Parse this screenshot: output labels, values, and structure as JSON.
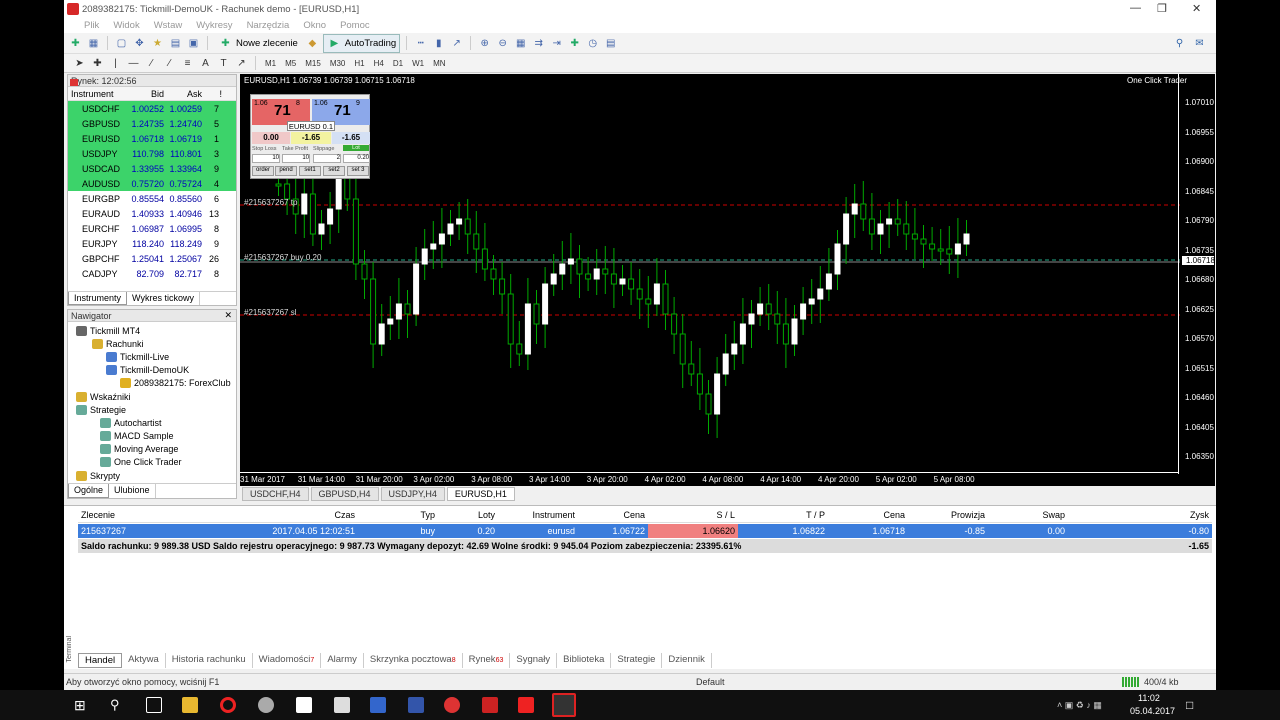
{
  "window": {
    "title": "2089382175: Tickmill-DemoUK - Rachunek demo - [EURUSD,H1]"
  },
  "menu": [
    "Plik",
    "Widok",
    "Wstaw",
    "Wykresy",
    "Narzędzia",
    "Okno",
    "Pomoc"
  ],
  "toolbar": {
    "new_order": "Nowe zlecenie",
    "autotrading": "AutoTrading",
    "timeframes": [
      "M1",
      "M5",
      "M15",
      "M30",
      "H1",
      "H4",
      "D1",
      "W1",
      "MN"
    ]
  },
  "market_watch": {
    "title": "Rynek: 12:02:56",
    "headers": [
      "Instrument",
      "Bid",
      "Ask",
      "!"
    ],
    "rows": [
      {
        "sym": "USDCHF",
        "bid": "1.00252",
        "ask": "1.00259",
        "spread": "7",
        "hl": true
      },
      {
        "sym": "GBPUSD",
        "bid": "1.24735",
        "ask": "1.24740",
        "spread": "5",
        "hl": true
      },
      {
        "sym": "EURUSD",
        "bid": "1.06718",
        "ask": "1.06719",
        "spread": "1",
        "hl": true
      },
      {
        "sym": "USDJPY",
        "bid": "110.798",
        "ask": "110.801",
        "spread": "3",
        "hl": true
      },
      {
        "sym": "USDCAD",
        "bid": "1.33955",
        "ask": "1.33964",
        "spread": "9",
        "hl": true
      },
      {
        "sym": "AUDUSD",
        "bid": "0.75720",
        "ask": "0.75724",
        "spread": "4",
        "hl": true
      },
      {
        "sym": "EURGBP",
        "bid": "0.85554",
        "ask": "0.85560",
        "spread": "6",
        "hl": false
      },
      {
        "sym": "EURAUD",
        "bid": "1.40933",
        "ask": "1.40946",
        "spread": "13",
        "hl": false
      },
      {
        "sym": "EURCHF",
        "bid": "1.06987",
        "ask": "1.06995",
        "spread": "8",
        "hl": false
      },
      {
        "sym": "EURJPY",
        "bid": "118.240",
        "ask": "118.249",
        "spread": "9",
        "hl": false
      },
      {
        "sym": "GBPCHF",
        "bid": "1.25041",
        "ask": "1.25067",
        "spread": "26",
        "hl": false
      },
      {
        "sym": "CADJPY",
        "bid": "82.709",
        "ask": "82.717",
        "spread": "8",
        "hl": false
      }
    ],
    "tabs": [
      "Instrumenty",
      "Wykres tickowy"
    ]
  },
  "navigator": {
    "title": "Nawigator",
    "items": [
      "Tickmill MT4",
      "Rachunki",
      "Tickmill-Live",
      "Tickmill-DemoUK",
      "2089382175: ForexClub",
      "Wskaźniki",
      "Strategie",
      "Autochartist",
      "MACD Sample",
      "Moving Average",
      "One Click Trader",
      "Skrypty"
    ],
    "tabs": [
      "Ogólne",
      "Ulubione"
    ]
  },
  "chart": {
    "header": "EURUSD,H1  1.06739 1.06739 1.06715 1.06718",
    "one_click": "One Click Trader",
    "prices": [
      "1.07010",
      "1.06955",
      "1.06900",
      "1.06845",
      "1.06790",
      "1.06735",
      "1.06680",
      "1.06625",
      "1.06570",
      "1.06515",
      "1.06460",
      "1.06405",
      "1.06350"
    ],
    "current_price": "1.06718",
    "times": [
      "31 Mar 2017",
      "31 Mar 14:00",
      "31 Mar 20:00",
      "3 Apr 02:00",
      "3 Apr 08:00",
      "3 Apr 14:00",
      "3 Apr 20:00",
      "4 Apr 02:00",
      "4 Apr 08:00",
      "4 Apr 14:00",
      "4 Apr 20:00",
      "5 Apr 02:00",
      "5 Apr 08:00"
    ],
    "line_tp": "#215637267 tp",
    "line_buy": "#215637267  buy 0.20",
    "line_sl": "#215637267 sl",
    "tabs": [
      "USDCHF,H4",
      "GBPUSD,H4",
      "USDJPY,H4",
      "EURUSD,H1"
    ],
    "panel": {
      "sell_big": "71",
      "sell_pre": "1.06",
      "sell_post": "8",
      "buy_big": "71",
      "buy_pre": "1.06",
      "buy_post": "9",
      "symbol": "EURUSD 0.1",
      "left": "0.00",
      "mid": "-1.65",
      "right": "-1.65",
      "sl": "Stop Loss",
      "tp": "Take Profit",
      "slip": "Slippage",
      "lot": "Lot",
      "sl_v": "10",
      "tp_v": "10",
      "slip_v": "2",
      "lot_v": "0.20",
      "b1": "order",
      "b2": "pend",
      "b3": "set1",
      "b4": "set2",
      "b5": "set 3"
    }
  },
  "terminal": {
    "headers": [
      "Zlecenie",
      "Czas",
      "Typ",
      "Loty",
      "Instrument",
      "Cena",
      "S / L",
      "T / P",
      "Cena",
      "Prowizja",
      "Swap",
      "Zysk"
    ],
    "order": [
      "215637267",
      "2017.04.05 12:02:51",
      "buy",
      "0.20",
      "eurusd",
      "1.06722",
      "1.06620",
      "1.06822",
      "1.06718",
      "-0.85",
      "0.00",
      "-0.80"
    ],
    "balance": "Saldo rachunku: 9 989.38 USD  Saldo rejestru operacyjnego: 9 987.73  Wymagany depozyt: 42.69  Wolne środki: 9 945.04  Poziom zabezpieczenia: 23395.61%",
    "balance_profit": "-1.65",
    "tabs": [
      {
        "l": "Handel",
        "b": ""
      },
      {
        "l": "Aktywa",
        "b": ""
      },
      {
        "l": "Historia rachunku",
        "b": ""
      },
      {
        "l": "Wiadomości",
        "b": "7"
      },
      {
        "l": "Alarmy",
        "b": ""
      },
      {
        "l": "Skrzynka pocztowa",
        "b": "8"
      },
      {
        "l": "Rynek",
        "b": "63"
      },
      {
        "l": "Sygnały",
        "b": ""
      },
      {
        "l": "Biblioteka",
        "b": ""
      },
      {
        "l": "Strategie",
        "b": ""
      },
      {
        "l": "Dziennik",
        "b": ""
      }
    ],
    "side": "Terminal"
  },
  "status": {
    "help": "Aby otworzyć okno pomocy, wciśnij F1",
    "profile": "Default",
    "traffic": "400/4 kb"
  },
  "taskbar": {
    "time": "11:02",
    "date": "05.04.2017"
  }
}
